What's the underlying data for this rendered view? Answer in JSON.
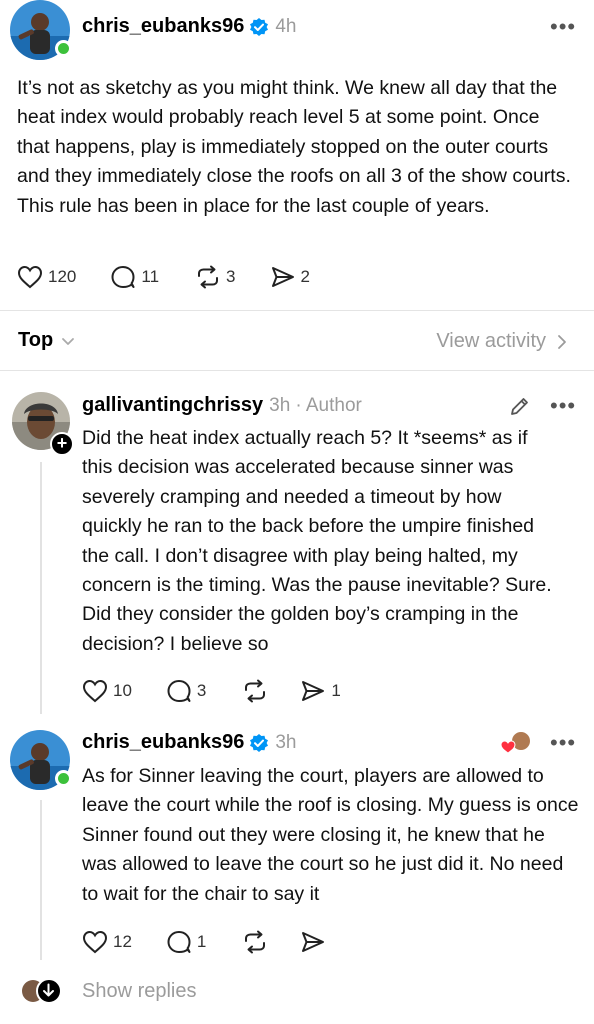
{
  "post": {
    "username": "chris_eubanks96",
    "time": "4h",
    "text": "It’s not as sketchy as you might think. We knew all day that the heat index would probably reach level 5 at some point. Once that happens, play is immediately stopped on the outer courts and they immediately close the roofs on all 3 of the show courts. This rule has been in place for the last couple of years.",
    "likes": "120",
    "comments": "11",
    "reposts": "3",
    "shares": "2"
  },
  "sort": {
    "label": "Top",
    "view_activity": "View activity"
  },
  "reply1": {
    "username": "gallivantingchrissy",
    "time": "3h",
    "author_label": "· Author",
    "text": "Did the heat index actually reach 5? It *seems* as if this decision was accelerated because sinner was severely cramping and needed a timeout by how quickly he ran to the back before the umpire finished  the call. I don’t disagree with play being halted, my concern is the timing. Was the pause inevitable? Sure. Did they consider the golden boy’s cramping in the decision? I believe so",
    "likes": "10",
    "comments": "3",
    "shares": "1"
  },
  "reply2": {
    "username": "chris_eubanks96",
    "time": "3h",
    "text": "As for Sinner leaving the court, players are allowed to leave the court while the roof is closing. My guess is once Sinner found out they were closing it, he knew that he was allowed to leave the court so he just did it. No need to wait for the chair to say it",
    "likes": "12",
    "comments": "1"
  },
  "footer": {
    "show_replies": "Show replies"
  },
  "icons": {
    "verified": "verified-badge-icon",
    "more": "more-horizontal-icon",
    "like": "heart-outline-icon",
    "comment": "speech-bubble-icon",
    "repost": "repost-arrows-icon",
    "share": "send-paper-plane-icon",
    "edit": "pencil-icon",
    "sort_chevron": "chevron-down-icon",
    "activity_chevron": "chevron-right-icon",
    "liked_by_author": "red-heart-badge"
  },
  "colors": {
    "verified_blue": "#0095f6",
    "online_green": "#3cc13b",
    "muted_text": "#9b9b9b",
    "like_red": "#ff3040"
  }
}
